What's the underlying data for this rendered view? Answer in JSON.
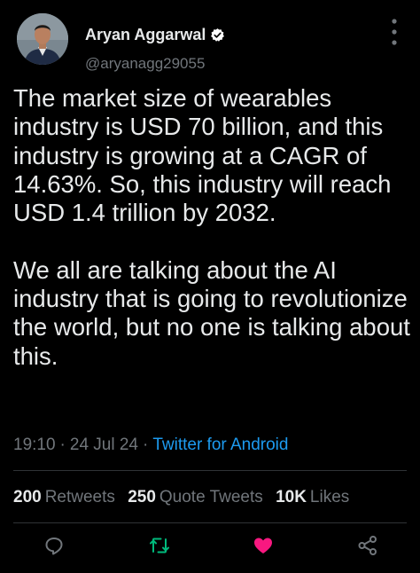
{
  "author": {
    "display_name": "Aryan Aggarwal",
    "handle": "@aryanagg29055",
    "verified": true,
    "avatar_icon": "profile-photo"
  },
  "tweet": {
    "paragraphs": [
      "The market size of wearables industry is USD 70 billion, and this industry is growing at a CAGR of 14.63%. So, this industry will reach USD 1.4 trillion by 2032.",
      "We all are talking about the AI industry that is going to revolutionize the world, but no one is talking about this."
    ],
    "time": "19:10",
    "date": "24 Jul 24",
    "source": "Twitter for Android",
    "separator": "·"
  },
  "stats": {
    "retweets": {
      "count": "200",
      "label": "Retweets"
    },
    "quote_tweets": {
      "count": "250",
      "label": "Quote Tweets"
    },
    "likes": {
      "count": "10K",
      "label": "Likes"
    }
  },
  "actions": [
    "reply-icon",
    "retweet-icon",
    "like-icon",
    "share-icon"
  ],
  "colors": {
    "background": "#000000",
    "text": "#e7e9ea",
    "secondary_text": "#71767b",
    "link": "#1d9bf0",
    "verified_badge": "#ffffff",
    "retweet_icon": "#00ba7c",
    "like_icon": "#f91880",
    "divider": "#2f3336"
  }
}
